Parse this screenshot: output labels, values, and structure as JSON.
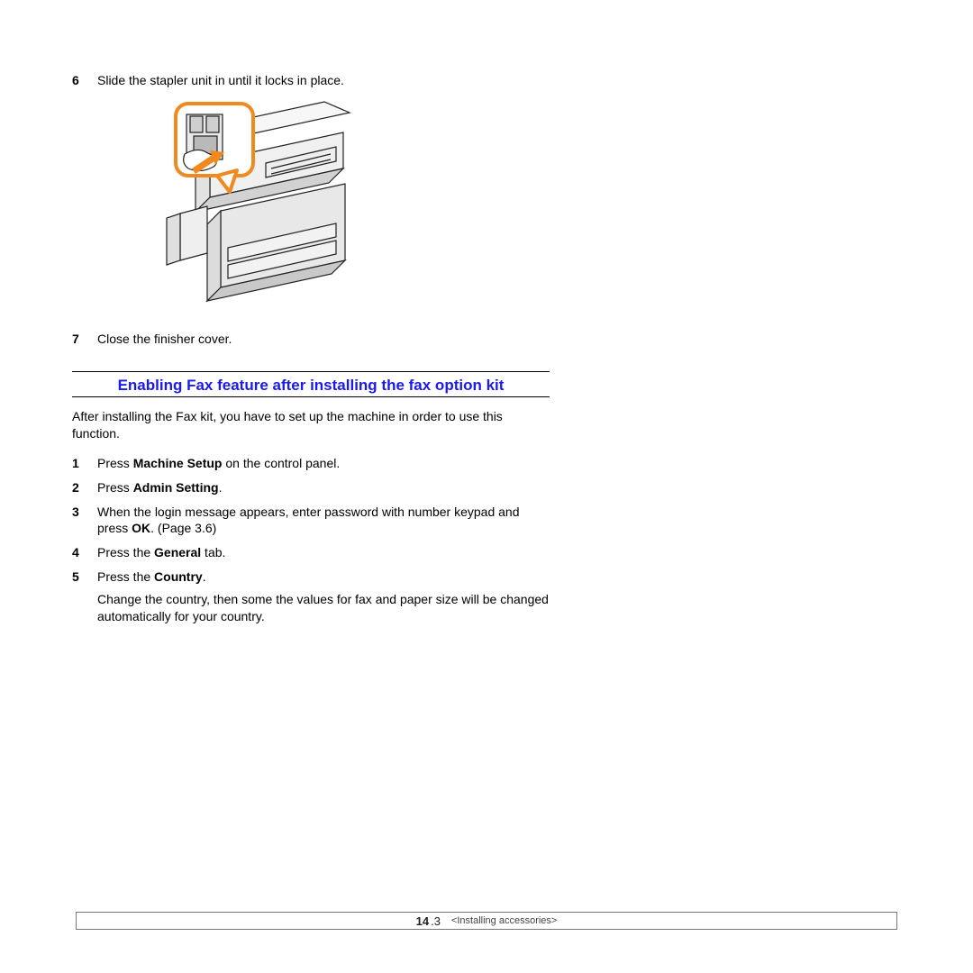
{
  "steps_top": [
    {
      "num": "6",
      "text": "Slide the stapler unit in until it locks in place."
    },
    {
      "num": "7",
      "text": "Close the finisher cover."
    }
  ],
  "section_title": "Enabling Fax feature after installing the fax option kit",
  "intro_para": "After installing the Fax kit, you have to set up the machine in order to use this function.",
  "steps_bottom": [
    {
      "num": "1",
      "before": "Press ",
      "bold": "Machine Setup",
      "after": " on the control panel."
    },
    {
      "num": "2",
      "before": "Press ",
      "bold": "Admin Setting",
      "after": "."
    },
    {
      "num": "3",
      "before": "When the login message appears, enter password with number keypad and press ",
      "bold": "OK",
      "after": ". (Page 3.6)"
    },
    {
      "num": "4",
      "before": "Press the ",
      "bold": "General",
      "after": " tab."
    },
    {
      "num": "5",
      "before": "Press the ",
      "bold": "Country",
      "after": ".",
      "note": "Change the country, then some the values for fax and paper size will be changed automatically for your country."
    }
  ],
  "footer": {
    "page_strong": "14",
    "page_sub": ".3",
    "crumb": "<Installing accessories>"
  }
}
